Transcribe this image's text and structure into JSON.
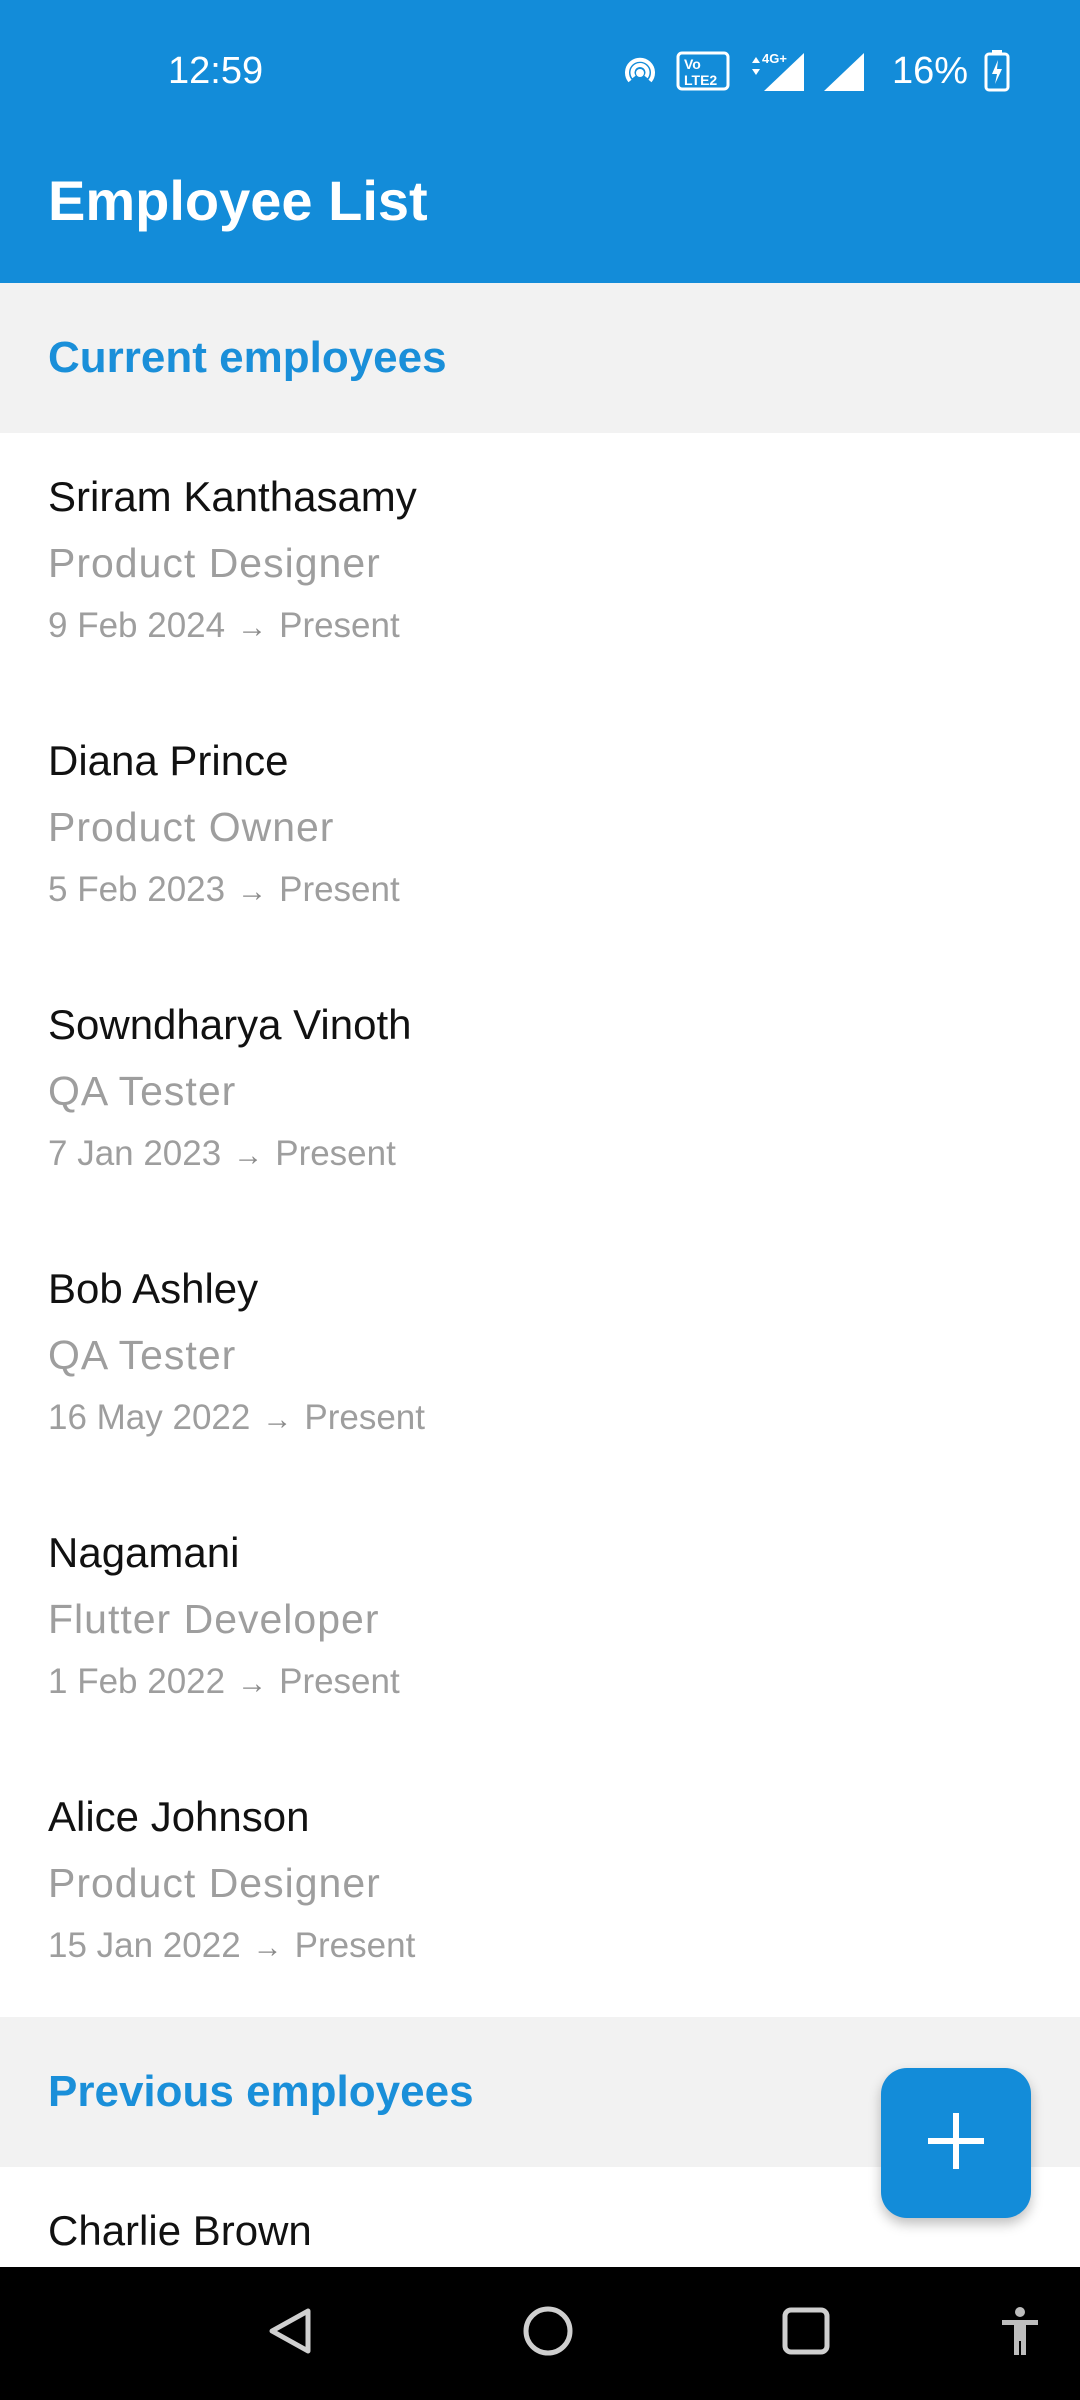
{
  "status_bar": {
    "time": "12:59",
    "battery_percent": "16%",
    "icons": [
      "hotspot-icon",
      "volte-icon",
      "4g-data-icon",
      "signal-icon",
      "battery-icon"
    ]
  },
  "app_bar": {
    "title": "Employee List",
    "color": "#138cd9"
  },
  "sections": {
    "current": {
      "title": "Current employees",
      "employees": [
        {
          "name": "Sriram Kanthasamy",
          "role": "Product Designer",
          "start": "9 Feb 2024",
          "end": "Present"
        },
        {
          "name": "Diana Prince",
          "role": "Product Owner",
          "start": "5 Feb 2023",
          "end": "Present"
        },
        {
          "name": "Sowndharya Vinoth",
          "role": "QA Tester",
          "start": "7 Jan 2023",
          "end": "Present"
        },
        {
          "name": "Bob Ashley",
          "role": "QA Tester",
          "start": "16 May 2022",
          "end": "Present"
        },
        {
          "name": "Nagamani",
          "role": "Flutter Developer",
          "start": "1 Feb 2022",
          "end": "Present"
        },
        {
          "name": "Alice Johnson",
          "role": "Product Designer",
          "start": "15 Jan 2022",
          "end": "Present"
        }
      ]
    },
    "previous": {
      "title": "Previous employees",
      "employees": [
        {
          "name": "Charlie Brown"
        }
      ]
    }
  },
  "date_arrow": "→",
  "fab": {
    "icon": "plus-icon"
  },
  "nav_bar": {
    "icons": [
      "back-icon",
      "home-icon",
      "recents-icon",
      "accessibility-icon"
    ]
  },
  "colors": {
    "accent": "#1a8fd9",
    "section_bg": "#f2f2f2",
    "secondary_text": "#9e9e9e"
  }
}
